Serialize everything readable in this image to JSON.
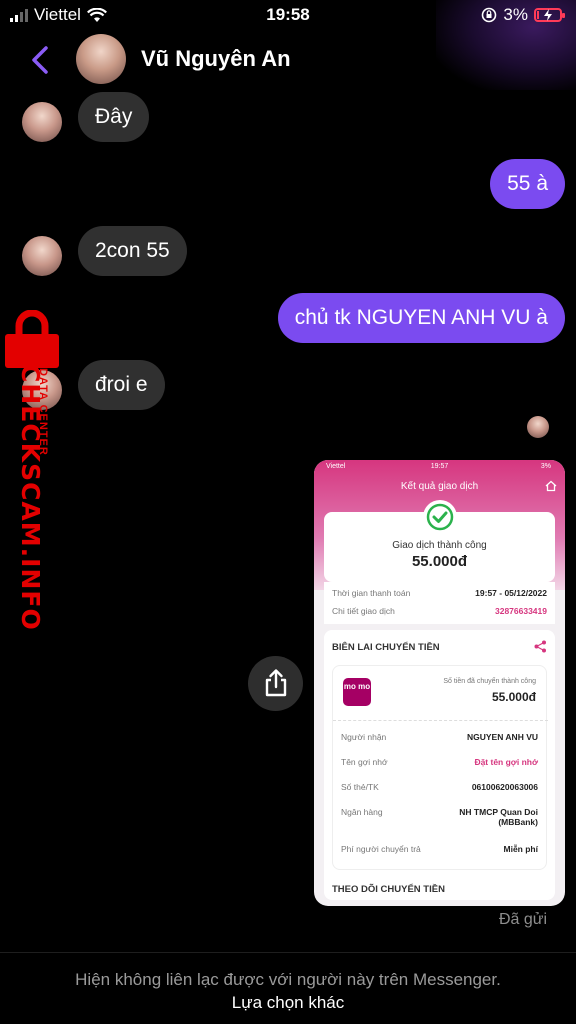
{
  "status_bar": {
    "carrier": "Viettel",
    "time": "19:58",
    "battery": "3%",
    "battery_color": "#ff3b58"
  },
  "header": {
    "contact_name": "Vũ Nguyên An",
    "back_icon": "chevron-left-icon",
    "accent": "#8b5cf6"
  },
  "messages": [
    {
      "from": "them",
      "text": "Đây"
    },
    {
      "from": "me",
      "text": "55 à"
    },
    {
      "from": "them",
      "text": "2con 55"
    },
    {
      "from": "me",
      "text": "chủ tk NGUYEN ANH VU à"
    },
    {
      "from": "them",
      "text": "đroi e"
    }
  ],
  "bubble_colors": {
    "incoming": "#303030",
    "outgoing": "#7b4bf0"
  },
  "watermark": {
    "text": "CHECKSCAM.INFO",
    "sub": "DATA CENTER",
    "color": "#e30000"
  },
  "receipt": {
    "status_carrier": "Viettel",
    "status_time": "19:57",
    "status_battery": "3%",
    "title": "Kết quả giao dịch",
    "success_text": "Giao dịch thành công",
    "amount": "55.000đ",
    "time_label": "Thời gian thanh toán",
    "time_value": "19:57 - 05/12/2022",
    "detail_label": "Chi tiết giao dịch",
    "detail_value": "32876633419",
    "section_title": "BIÊN LAI CHUYỂN TIỀN",
    "logo_text": "mo mo",
    "sent_label": "Số tiền đã chuyển thành công",
    "sent_value": "55.000đ",
    "rows": [
      {
        "label": "Người nhận",
        "value": "NGUYEN ANH VU"
      },
      {
        "label": "Tên gợi nhớ",
        "value": "Đặt tên gợi nhớ"
      },
      {
        "label": "Số thẻ/TK",
        "value": "06100620063006"
      },
      {
        "label": "Ngân hàng",
        "value": "NH TMCP Quan Doi (MBBank)"
      },
      {
        "label": "Phí người chuyển trả",
        "value": "Miễn phí"
      }
    ],
    "follow_title": "THEO DÕI CHUYỂN TIỀN"
  },
  "sent_status": "Đã gửi",
  "footer": {
    "note": "Hiện không liên lạc được với người này trên Messenger.",
    "option": "Lựa chọn khác"
  }
}
